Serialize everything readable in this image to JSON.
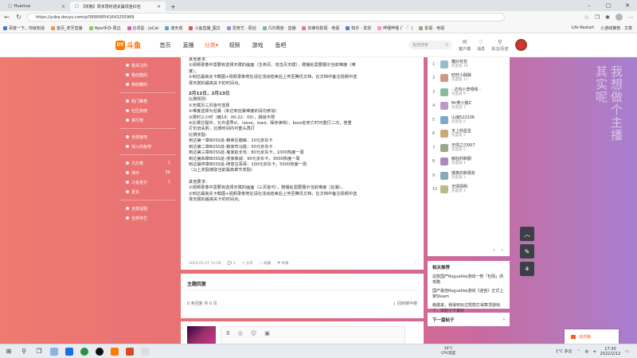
{
  "browser": {
    "tabs": [
      {
        "title": "Huamus"
      },
      {
        "title": "【攻略】周末限时通关赢现金红包"
      }
    ],
    "new_tab": "+",
    "url": "https://yuba.douyu.com/p/589008541643255969",
    "lock": "🔒",
    "favorites": [
      "百度一下，你就知道",
      "首页_虎牙直播",
      "Hpei手办·周边",
      "比邻星 · JoCat",
      "通天塔",
      "斗鱼直播_图文",
      "爱奇艺 · 原创",
      "凡尔赛宫 · 直播",
      "好莱坞影视 · 电视",
      "知乎 · 发现",
      "哔哩哔哩 (゜-゜)",
      "影视 · 电视"
    ],
    "favorites_right": [
      "Life Restart",
      "小游戏推荐 · 文章"
    ]
  },
  "site": {
    "logo_text": "斗鱼",
    "logo_badge": "DY",
    "menu": [
      "首页",
      "直播",
      "分类▾",
      "视频",
      "游戏",
      "鱼吧"
    ],
    "search_placeholder": "鱼吧搜索",
    "header_icons": [
      {
        "icon": "✉",
        "label": "客户端"
      },
      {
        "icon": "♡",
        "label": "消息"
      },
      {
        "icon": "⚲",
        "label": "关注/历史"
      }
    ]
  },
  "sidebar": {
    "group1": [
      "我关注的",
      "我创建的",
      "我收藏的"
    ],
    "group2": [
      "热门推荐",
      "社区热榜",
      "排行榜"
    ],
    "group3": [
      "全部鱼吧",
      "加入的鱼吧"
    ],
    "group4": [
      {
        "label": "凡尔赛",
        "count": "1"
      },
      {
        "label": "演示",
        "count": "56"
      },
      {
        "label": "斗鱼官方",
        "count": "1"
      },
      {
        "label": "更多",
        "count": ""
      }
    ],
    "group5": [
      "全部话题",
      "全部专栏"
    ]
  },
  "post": {
    "lines_top": [
      "其他要求：",
      "①视频录像中需要有选择天赋的画面（生命页、攻击页天赋），赠播处需要展示当前难度（难",
      "度）。",
      "②到达最高关卡截图+视频录像地址请在活动结束后上传至腾讯文档，在文档中备注视频中选",
      "择天赋的最高关卡的时间点。"
    ],
    "section_title": "2月12日，2月13日",
    "lines_mid": [
      "比赛规则：",
      "①天赋页三页皆可选择",
      "②难度选择为狂暴（未达到狂暴难度的请勿参加）",
      "③限时三小时（晚19：00-22：00），跳级不限",
      "④比赛过程中，允许退界sl，（save，load，保存读档），boss处死亡时可重打二次，若重",
      "打仍旧失败，比赛时间内可重头再打",
      "比赛奖励：",
      "到达第一章BOSS处-精英巨蜘蛛：20元京东卡",
      "到达第二章BOSS处-鹅家司马懿：50元京东卡",
      "到达第三章BOSS处-鬼家赵长毛：80元京东卡，1000热度一周",
      "到达第四章BOSS处-虎家孝诚：90元京东卡，3000热度一周",
      "到达最终章BOSS处-随意宝哥哥：100元京东卡，5000热度一周",
      "（以上奖励按取当前最高章节奖励）"
    ],
    "lines_bottom": [
      "其他要求：",
      "①视频录像中需要有选择天赋的画面（三页皆可），赠播处需要展示当前难度（狂暴），",
      "②到达最高关卡截图+视频录像地址请在活动结束后上传至腾讯文档，在文档中备注视频中选",
      "择天赋的最高关卡的时间点。"
    ],
    "footer": {
      "time": "2022-01-27 11:59",
      "comments": "💬 3",
      "share": "↗ 分享",
      "fav": "☆ 收藏",
      "report": "⚑ 举报",
      "more": "⋮"
    }
  },
  "related": {
    "title": "主题回复",
    "left": "0 条回复 共 0 页",
    "right": "↓ 回到楼中楼"
  },
  "reply": {
    "tools": [
      "B",
      "◎",
      "☺",
      "▣"
    ]
  },
  "ranking": [
    {
      "rank": "1",
      "name": "糖炒花花",
      "sub": "热度值 19"
    },
    {
      "rank": "2",
      "name": "旺旺小酥酥",
      "sub": "热度值 11"
    },
    {
      "rank": "3",
      "name": "- 达鸡小李嘻嘻 -",
      "sub": "热度值 9"
    },
    {
      "rank": "4",
      "name": "Mr菱小猴Z",
      "sub": "热度值 7"
    },
    {
      "rank": "5",
      "name": "山海522206",
      "sub": "热度值 6"
    },
    {
      "rank": "6",
      "name": "天上的星星",
      "sub": "热度值 5"
    },
    {
      "rank": "7",
      "name": "无情之刃007",
      "sub": "热度值 5"
    },
    {
      "rank": "8",
      "name": "鹌狂的制服",
      "sub": "热度值 4"
    },
    {
      "rank": "9",
      "name": "拽真的新朋友",
      "sub": "热度值 3"
    },
    {
      "rank": "10",
      "name": "无情情明",
      "sub": "热度值 3"
    }
  ],
  "ranking_pager": [
    "‹",
    "›"
  ],
  "recommend": {
    "title": "相关推荐",
    "items": [
      "这款国产Roguelike游戏一荐「杜院」的攻略",
      "国产最佳Roguelike游戏《迷宫》正式上架Steam",
      "萌邀来，我得到玩过帮帮打得算顶游戏了，体验了下真好"
    ]
  },
  "next_post": {
    "label": "下一篇帖子",
    "arrow": "›"
  },
  "floating": [
    "︿",
    "✎",
    "⚘"
  ],
  "decoration": [
    [
      "我",
      "其"
    ],
    [
      "想",
      "实"
    ],
    [
      "做",
      "呢"
    ],
    [
      "个",
      ""
    ],
    [
      "主",
      ""
    ],
    [
      "播",
      ""
    ]
  ],
  "toast": "动作跑",
  "taskbar": {
    "weather_temp": "38°C",
    "weather_label": "CPU温度",
    "tray_temp": "1°C 多云",
    "time": "17:30",
    "date": "2022/2/12"
  }
}
